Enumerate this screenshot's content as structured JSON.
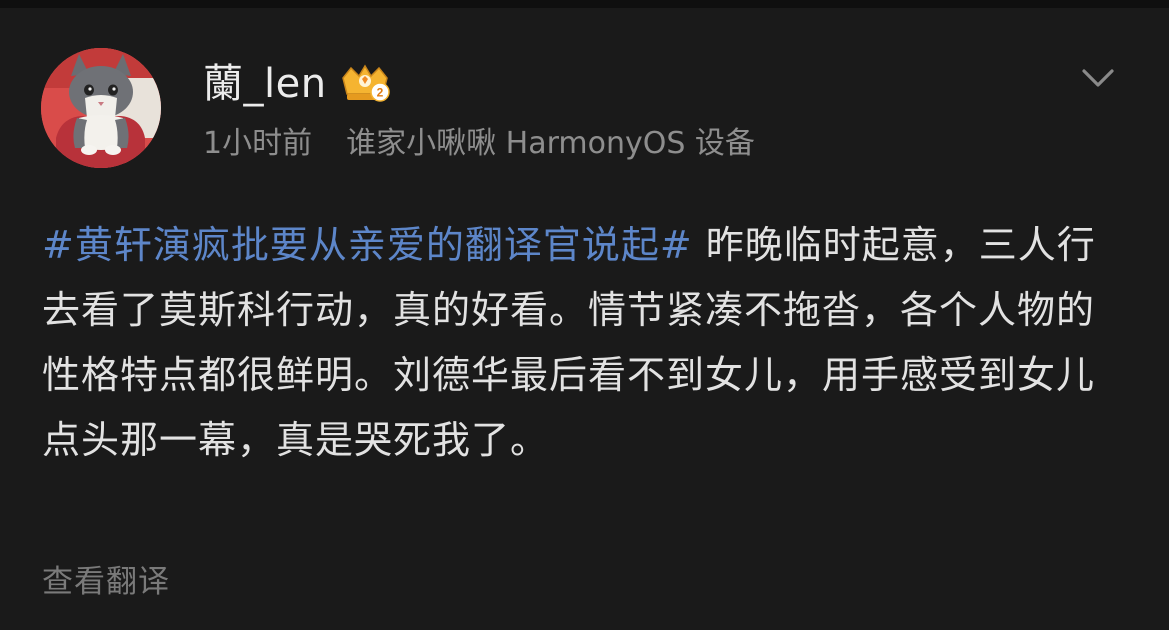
{
  "post": {
    "username": "蘭_len",
    "badge_icon": "crown-rank-2-icon",
    "badge_number": "2",
    "time": "1小时前",
    "source": "谁家小啾啾 HarmonyOS 设备",
    "hashtag": "#黄轩演疯批要从亲爱的翻译官说起#",
    "text": " 昨晚临时起意，三人行去看了莫斯科行动，真的好看。情节紧凑不拖沓，各个人物的性格特点都很鲜明。刘德华最后看不到女儿，用手感受到女儿点头那一幕，真是哭死我了。",
    "translate_label": "查看翻译",
    "more_icon": "chevron-down-icon",
    "avatar_icon": "cat-avatar-icon"
  },
  "colors": {
    "background": "#1a1a1a",
    "username": "#ececec",
    "meta": "#8e8e8e",
    "body_text": "#e2e2e2",
    "hashtag": "#5d86c9",
    "translate": "#7a7a7a",
    "crown": "#f5b431"
  }
}
